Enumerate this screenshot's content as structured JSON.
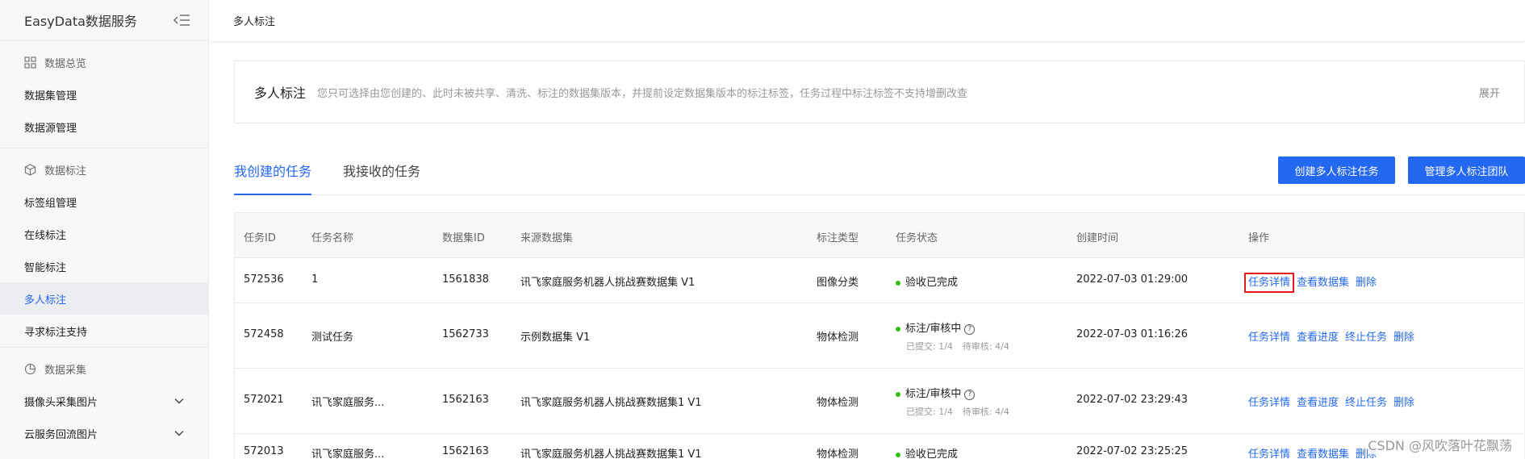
{
  "sidebar": {
    "brand": "EasyData数据服务",
    "groups": [
      {
        "title": "数据总览",
        "icon": "grid-icon",
        "items": [
          "数据集管理",
          "数据源管理"
        ]
      },
      {
        "title": "数据标注",
        "icon": "cube-icon",
        "items": [
          "标签组管理",
          "在线标注",
          "智能标注",
          "多人标注",
          "寻求标注支持"
        ]
      },
      {
        "title": "数据采集",
        "icon": "pie-chart-icon",
        "items": [
          "摄像头采集图片",
          "云服务回流图片"
        ]
      }
    ],
    "active_item": "多人标注"
  },
  "topbar": {
    "title": "多人标注"
  },
  "intro": {
    "title": "多人标注",
    "description": "您只可选择由您创建的、此时未被共享、清洗、标注的数据集版本，并提前设定数据集版本的标注标签，任务过程中标注标签不支持增删改查",
    "expand": "展开"
  },
  "tabs": [
    "我创建的任务",
    "我接收的任务"
  ],
  "active_tab": "我创建的任务",
  "buttons": {
    "create": "创建多人标注任务",
    "manage": "管理多人标注团队"
  },
  "table": {
    "headers": [
      "任务ID",
      "任务名称",
      "数据集ID",
      "来源数据集",
      "标注类型",
      "任务状态",
      "创建时间",
      "操作"
    ],
    "rows": [
      {
        "id": "572536",
        "name": "1",
        "dataset_id": "1561838",
        "source": "讯飞家庭服务机器人挑战赛数据集 V1",
        "type": "图像分类",
        "status": "验收已完成",
        "submitted": "",
        "pending": "",
        "time": "2022-07-03 01:29:00",
        "ops": [
          "任务详情",
          "查看数据集",
          "删除"
        ]
      },
      {
        "id": "572458",
        "name": "测试任务",
        "dataset_id": "1562733",
        "source": "示例数据集 V1",
        "type": "物体检测",
        "status": "标注/审核中",
        "submitted": "已提交: 1/4",
        "pending": "待审核: 4/4",
        "time": "2022-07-03 01:16:26",
        "ops": [
          "任务详情",
          "查看进度",
          "终止任务",
          "删除"
        ]
      },
      {
        "id": "572021",
        "name": "讯飞家庭服务...",
        "dataset_id": "1562163",
        "source": "讯飞家庭服务机器人挑战赛数据集1 V1",
        "type": "物体检测",
        "status": "标注/审核中",
        "submitted": "已提交: 1/4",
        "pending": "待审核: 4/4",
        "time": "2022-07-02 23:29:43",
        "ops": [
          "任务详情",
          "查看进度",
          "终止任务",
          "删除"
        ]
      },
      {
        "id": "572013",
        "name": "讯飞家庭服务...",
        "dataset_id": "1562163",
        "source": "讯飞家庭服务机器人挑战赛数据集1 V1",
        "type": "物体检测",
        "status": "验收已完成",
        "submitted": "",
        "pending": "",
        "time": "2022-07-02 23:25:25",
        "ops": [
          "任务详情",
          "查看数据集",
          "删除"
        ]
      }
    ]
  },
  "watermark": "CSDN @风吹落叶花飘荡",
  "colors": {
    "accent": "#2468f2",
    "success": "#30bf13",
    "highlight_box": "#e51c1c"
  }
}
